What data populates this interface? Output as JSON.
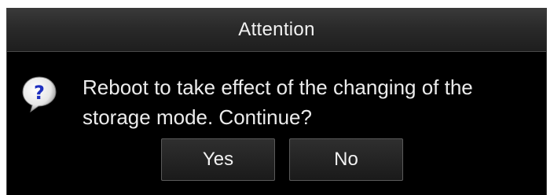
{
  "dialog": {
    "title": "Attention",
    "message": "Reboot to take effect of the changing of the storage mode. Continue?",
    "icon": "question-icon",
    "buttons": {
      "yes": "Yes",
      "no": "No"
    }
  },
  "colors": {
    "dialog_background": "#000000",
    "title_bar": "#2a2a2a",
    "text": "#ececec",
    "icon_blue": "#1e2fbf"
  }
}
